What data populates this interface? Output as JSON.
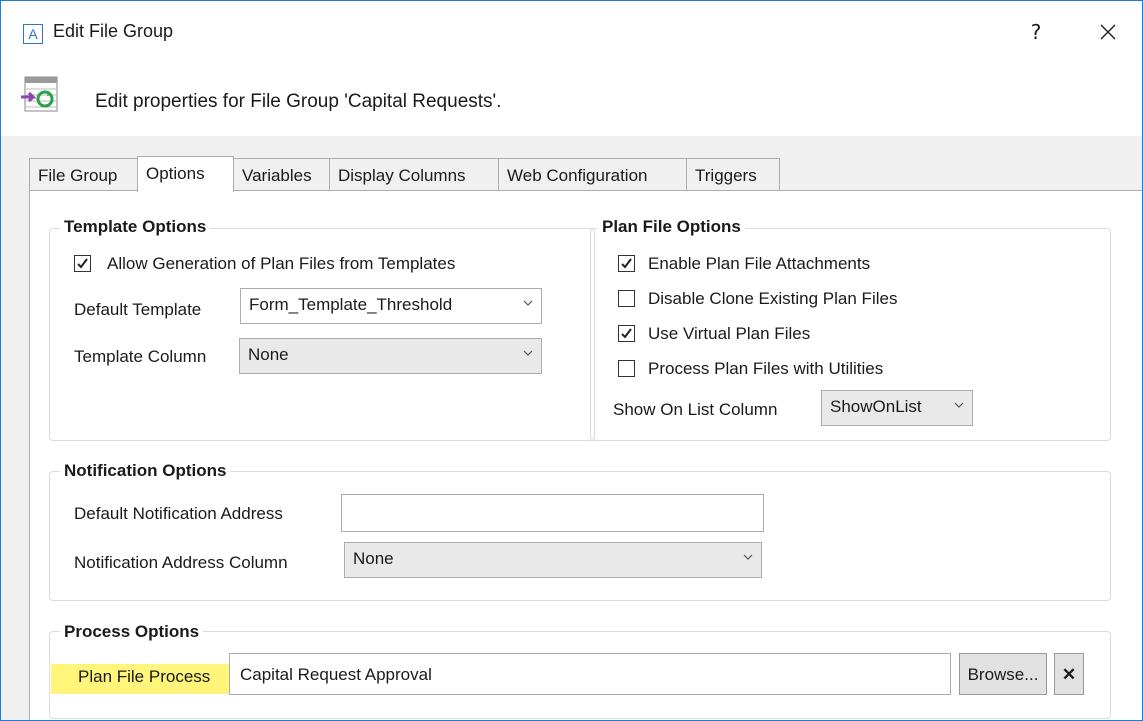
{
  "window": {
    "title": "Edit File Group",
    "app_icon_letter": "A",
    "help_label": "?"
  },
  "header": {
    "description": "Edit properties for File Group 'Capital Requests'."
  },
  "tabs": [
    {
      "label": "File Group",
      "active": false
    },
    {
      "label": "Options",
      "active": true
    },
    {
      "label": "Variables",
      "active": false
    },
    {
      "label": "Display Columns",
      "active": false
    },
    {
      "label": "Web Configuration",
      "active": false
    },
    {
      "label": "Triggers",
      "active": false
    }
  ],
  "template_options": {
    "legend": "Template Options",
    "allow_generation": {
      "label": "Allow Generation of Plan Files from Templates",
      "checked": true
    },
    "default_template": {
      "label": "Default Template",
      "value": "Form_Template_Threshold"
    },
    "template_column": {
      "label": "Template Column",
      "value": "None"
    }
  },
  "plan_file_options": {
    "legend": "Plan File Options",
    "checkboxes": [
      {
        "label": "Enable Plan File Attachments",
        "checked": true
      },
      {
        "label": "Disable Clone Existing Plan Files",
        "checked": false
      },
      {
        "label": "Use Virtual Plan Files",
        "checked": true
      },
      {
        "label": "Process Plan Files with Utilities",
        "checked": false
      }
    ],
    "show_on_list": {
      "label": "Show On List Column",
      "value": "ShowOnList"
    }
  },
  "notification_options": {
    "legend": "Notification Options",
    "default_address": {
      "label": "Default Notification Address",
      "value": ""
    },
    "address_column": {
      "label": "Notification Address Column",
      "value": "None"
    }
  },
  "process_options": {
    "legend": "Process Options",
    "plan_file_process": {
      "label": "Plan File Process",
      "value": "Capital Request Approval"
    },
    "browse_label": "Browse...",
    "clear_label": "✕"
  },
  "colors": {
    "accent": "#1e7bd6",
    "highlight": "#fff57a",
    "panel_bg": "#f0f0f0"
  },
  "icons": {
    "close": "close-icon",
    "header": "file-group-sync-icon",
    "dropdown": "chevron-down-icon",
    "check": "checkmark-icon"
  }
}
